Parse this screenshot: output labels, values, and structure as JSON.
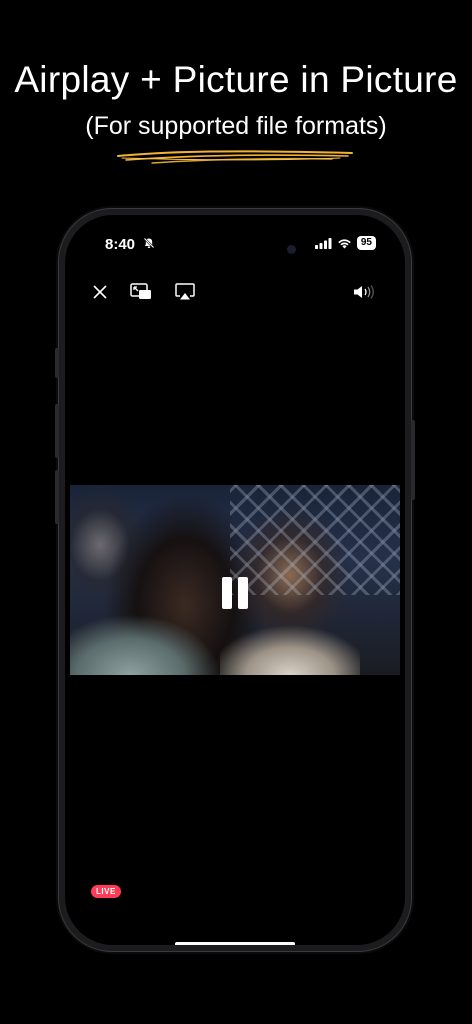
{
  "promo": {
    "title": "Airplay + Picture in Picture",
    "subtitle": "(For supported file formats)",
    "accent_color": "#f2b233"
  },
  "status_bar": {
    "time": "8:40",
    "silent_icon": "bell-slash-icon",
    "signal_icon": "cellular-signal-icon",
    "wifi_icon": "wifi-icon",
    "battery": "95"
  },
  "player": {
    "toolbar": {
      "close_icon": "close-icon",
      "pip_icon": "picture-in-picture-icon",
      "airplay_icon": "airplay-icon",
      "volume_icon": "speaker-volume-icon"
    },
    "state_icon": "pause-icon",
    "live_badge": "LIVE",
    "live_color": "#ff3b57"
  }
}
